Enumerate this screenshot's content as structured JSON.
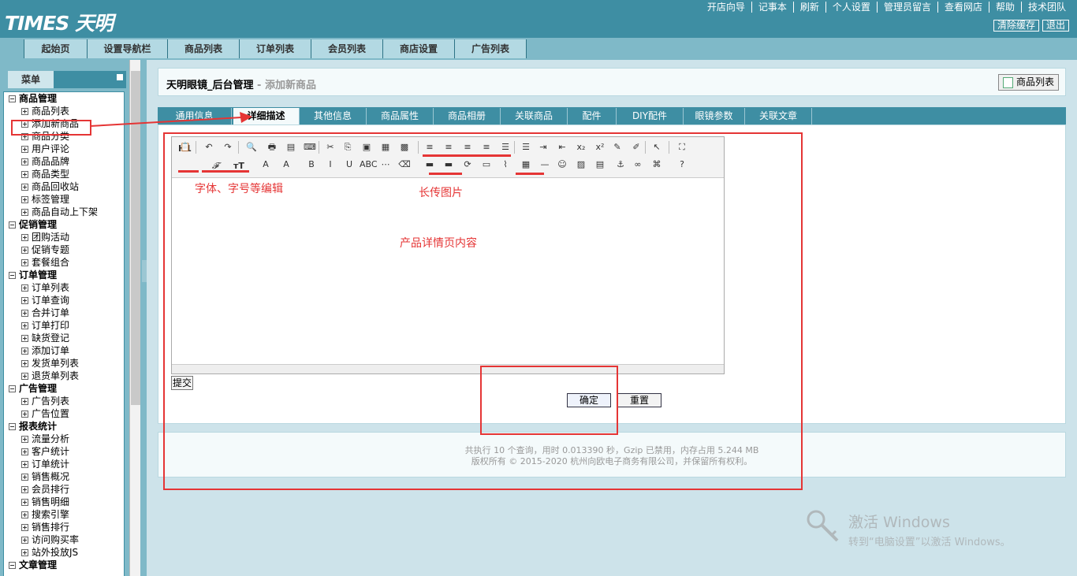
{
  "brand": {
    "logo": "TIMES 天明"
  },
  "top_links": [
    "开店向导",
    "记事本",
    "刷新",
    "个人设置",
    "管理员留言",
    "查看网店",
    "帮助",
    "技术团队"
  ],
  "top_buttons": {
    "clear_cache": "清除缓存",
    "logout": "退出"
  },
  "nav": [
    "起始页",
    "设置导航栏",
    "商品列表",
    "订单列表",
    "会员列表",
    "商店设置",
    "广告列表"
  ],
  "sidebar": {
    "title": "菜单",
    "groups": [
      {
        "label": "商品管理",
        "items": [
          "商品列表",
          "添加新商品",
          "商品分类",
          "用户评论",
          "商品品牌",
          "商品类型",
          "商品回收站",
          "标签管理",
          "商品自动上下架"
        ]
      },
      {
        "label": "促销管理",
        "items": [
          "团购活动",
          "促销专题",
          "套餐组合"
        ]
      },
      {
        "label": "订单管理",
        "items": [
          "订单列表",
          "订单查询",
          "合并订单",
          "订单打印",
          "缺货登记",
          "添加订单",
          "发货单列表",
          "退货单列表"
        ]
      },
      {
        "label": "广告管理",
        "items": [
          "广告列表",
          "广告位置"
        ]
      },
      {
        "label": "报表统计",
        "items": [
          "流量分析",
          "客户统计",
          "订单统计",
          "销售概况",
          "会员排行",
          "销售明细",
          "搜索引擎",
          "销售排行",
          "访问购买率",
          "站外投放JS"
        ]
      },
      {
        "label": "文章管理",
        "items": []
      }
    ]
  },
  "page": {
    "title": "天明眼镜_后台管理",
    "subtitle": " - 添加新商品",
    "list_button": "商品列表"
  },
  "tabs": [
    "通用信息",
    "详细描述",
    "其他信息",
    "商品属性",
    "商品相册",
    "关联商品",
    "配件",
    "DIY配件",
    "眼镜参数",
    "关联文章"
  ],
  "active_tab": "详细描述",
  "toolbar": {
    "heading": "H1",
    "font": "𝓕",
    "size": "ᴛT"
  },
  "annotations": {
    "font_note": "字体、字号等编辑",
    "image_note": "长传图片",
    "content_note": "产品详情页内容"
  },
  "buttons": {
    "submit": "提交",
    "confirm": "确定",
    "reset": "重置"
  },
  "footer": {
    "line1": "共执行 10 个查询，用时 0.013390 秒，Gzip 已禁用，内存占用 5.244 MB",
    "line2": "版权所有 © 2015-2020 杭州向欧电子商务有限公司，并保留所有权利。"
  },
  "watermark": {
    "line1": "激活 Windows",
    "line2": "转到“电脑设置”以激活 Windows。"
  },
  "colors": {
    "header": "#3e8ea3",
    "nav": "#7fb9c8",
    "background": "#cde3ea",
    "annotation": "#e53535"
  }
}
